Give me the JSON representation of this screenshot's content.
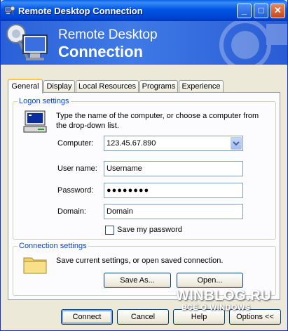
{
  "window": {
    "title": "Remote Desktop Connection",
    "icon": "remote-desktop-icon",
    "controls": {
      "minimize": "_",
      "maximize": "□",
      "close": "✕"
    }
  },
  "banner": {
    "line1": "Remote Desktop",
    "line2": "Connection"
  },
  "tabs": [
    {
      "label": "General",
      "active": true
    },
    {
      "label": "Display"
    },
    {
      "label": "Local Resources"
    },
    {
      "label": "Programs"
    },
    {
      "label": "Experience"
    }
  ],
  "logon": {
    "legend": "Logon settings",
    "instructions": "Type the name of the computer, or choose a computer from the drop-down list.",
    "computer_label": "Computer:",
    "computer_value": "123.45.67.890",
    "username_label": "User name:",
    "username_value": "Username",
    "password_label": "Password:",
    "password_value": "●●●●●●●●",
    "domain_label": "Domain:",
    "domain_value": "Domain",
    "save_password_label": "Save my password",
    "save_password_checked": false
  },
  "connection": {
    "legend": "Connection settings",
    "description": "Save current settings, or open saved connection.",
    "save_as_label": "Save As...",
    "open_label": "Open..."
  },
  "footer": {
    "connect_label": "Connect",
    "cancel_label": "Cancel",
    "help_label": "Help",
    "options_label": "Options <<"
  },
  "watermark": {
    "line1": "WINBLOG.RU",
    "line2": "ВСЁ О WINDOWS"
  }
}
